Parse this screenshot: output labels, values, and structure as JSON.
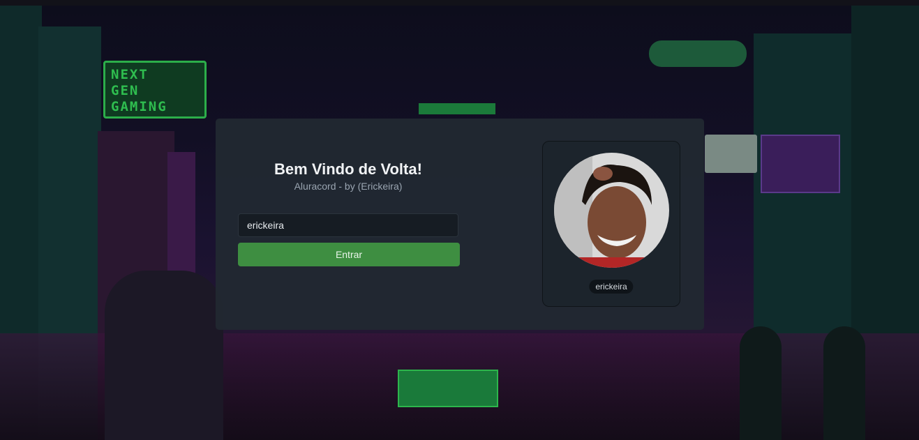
{
  "background": {
    "neon_sign": [
      "NEXT",
      "GEN",
      "GAMING"
    ]
  },
  "login": {
    "title": "Bem Vindo de Volta!",
    "subtitle": "Aluracord - by (Erickeira)",
    "username_value": "erickeira",
    "submit_label": "Entrar"
  },
  "profile": {
    "username": "erickeira"
  },
  "colors": {
    "accent": "#3e8e41",
    "card": "#212931",
    "panel": "#1c242c"
  }
}
